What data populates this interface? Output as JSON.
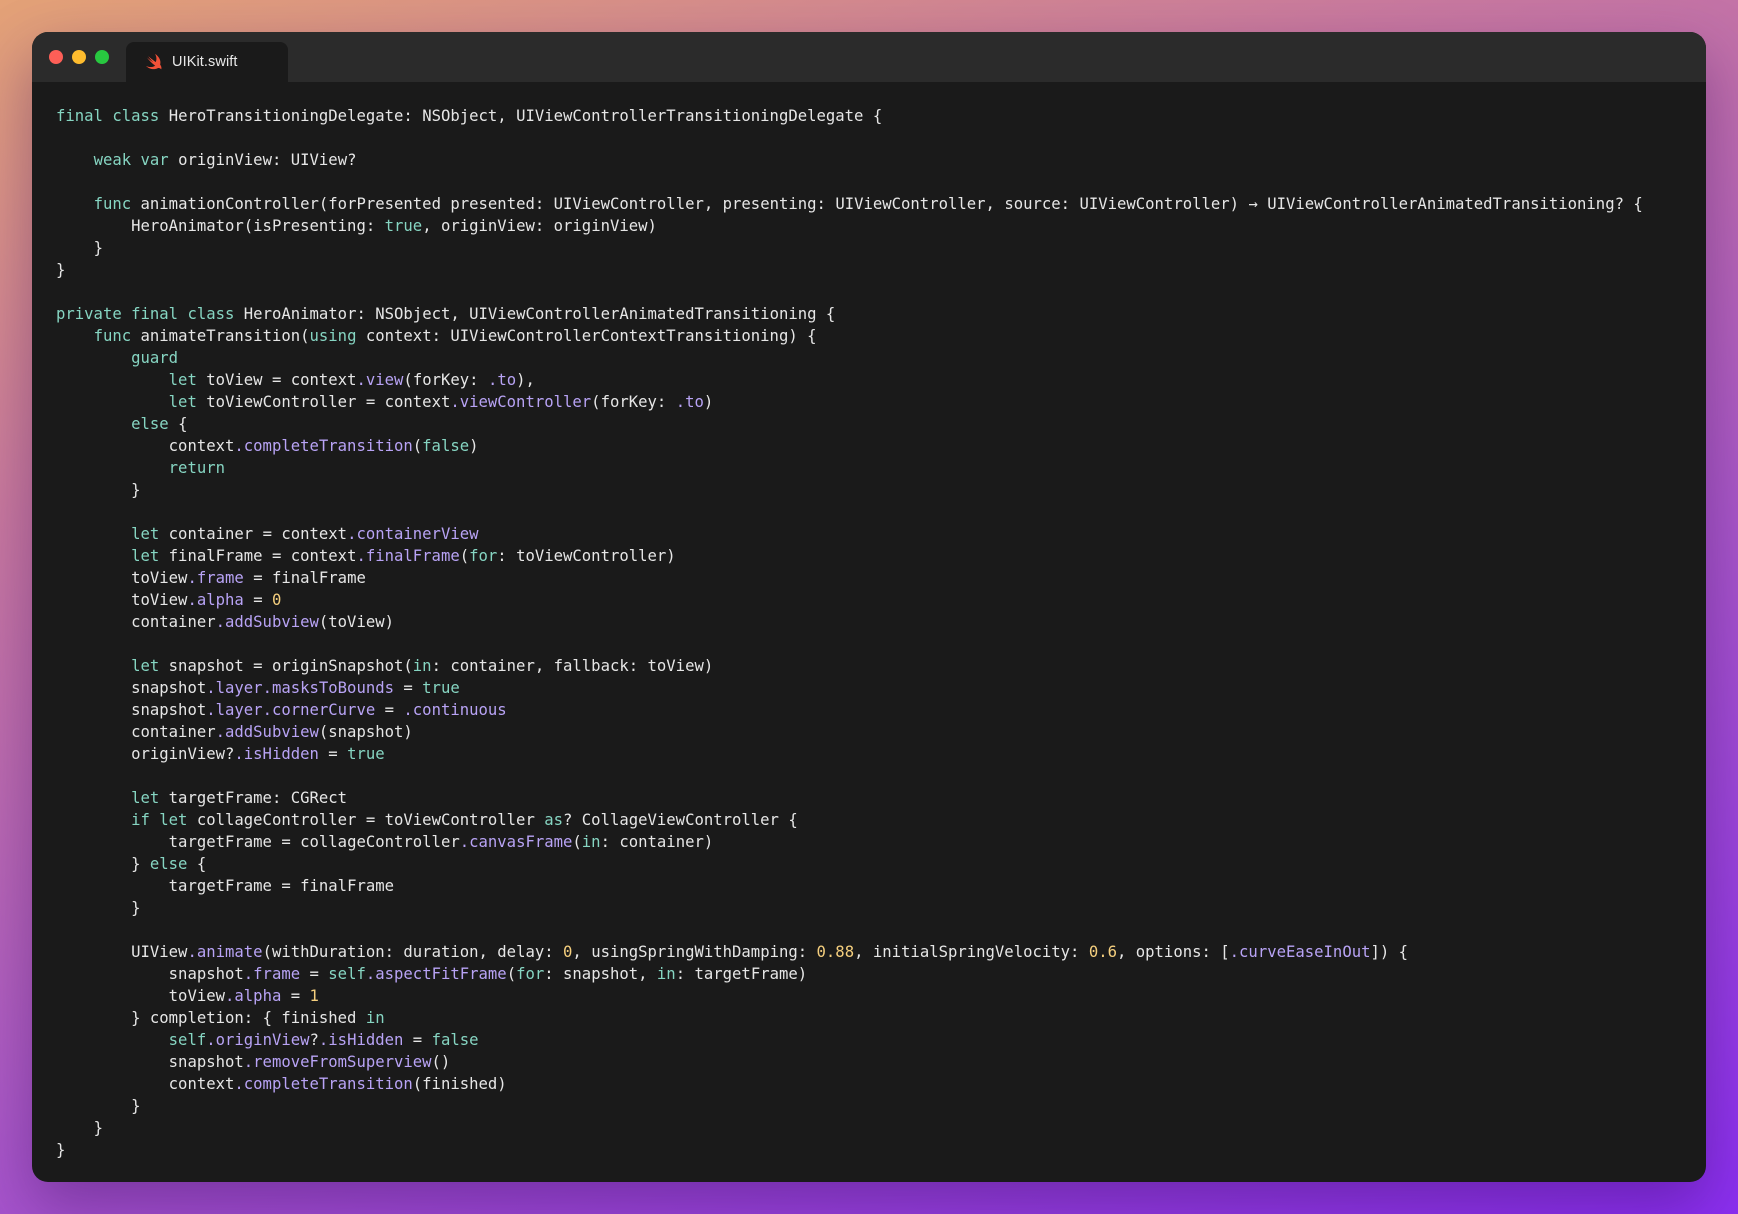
{
  "window": {
    "traffic_lights": [
      {
        "name": "close",
        "color": "#fe5f57"
      },
      {
        "name": "minimize",
        "color": "#febc2e"
      },
      {
        "name": "zoom",
        "color": "#28c840"
      }
    ],
    "tab": {
      "icon": "swift-icon",
      "label": "UIKit.swift"
    }
  },
  "theme": {
    "keyword_color": "#86d5c2",
    "member_color": "#b8a3f5",
    "number_color": "#f5cf7e",
    "text_color": "#e6e6e6",
    "editor_background": "#1a1a1a"
  },
  "code": {
    "language": "swift",
    "lines": [
      "final class HeroTransitioningDelegate: NSObject, UIViewControllerTransitioningDelegate {",
      "",
      "    weak var originView: UIView?",
      "",
      "    func animationController(forPresented presented: UIViewController, presenting: UIViewController, source: UIViewController) → UIViewControllerAnimatedTransitioning? {",
      "        HeroAnimator(isPresenting: true, originView: originView)",
      "    }",
      "}",
      "",
      "private final class HeroAnimator: NSObject, UIViewControllerAnimatedTransitioning {",
      "    func animateTransition(using context: UIViewControllerContextTransitioning) {",
      "        guard",
      "            let toView = context.view(forKey: .to),",
      "            let toViewController = context.viewController(forKey: .to)",
      "        else {",
      "            context.completeTransition(false)",
      "            return",
      "        }",
      "",
      "        let container = context.containerView",
      "        let finalFrame = context.finalFrame(for: toViewController)",
      "        toView.frame = finalFrame",
      "        toView.alpha = 0",
      "        container.addSubview(toView)",
      "",
      "        let snapshot = originSnapshot(in: container, fallback: toView)",
      "        snapshot.layer.masksToBounds = true",
      "        snapshot.layer.cornerCurve = .continuous",
      "        container.addSubview(snapshot)",
      "        originView?.isHidden = true",
      "",
      "        let targetFrame: CGRect",
      "        if let collageController = toViewController as? CollageViewController {",
      "            targetFrame = collageController.canvasFrame(in: container)",
      "        } else {",
      "            targetFrame = finalFrame",
      "        }",
      "",
      "        UIView.animate(withDuration: duration, delay: 0, usingSpringWithDamping: 0.88, initialSpringVelocity: 0.6, options: [.curveEaseInOut]) {",
      "            snapshot.frame = self.aspectFitFrame(for: snapshot, in: targetFrame)",
      "            toView.alpha = 1",
      "        } completion: { finished in",
      "            self.originView?.isHidden = false",
      "            snapshot.removeFromSuperview()",
      "            context.completeTransition(finished)",
      "        }",
      "    }",
      "}"
    ]
  }
}
